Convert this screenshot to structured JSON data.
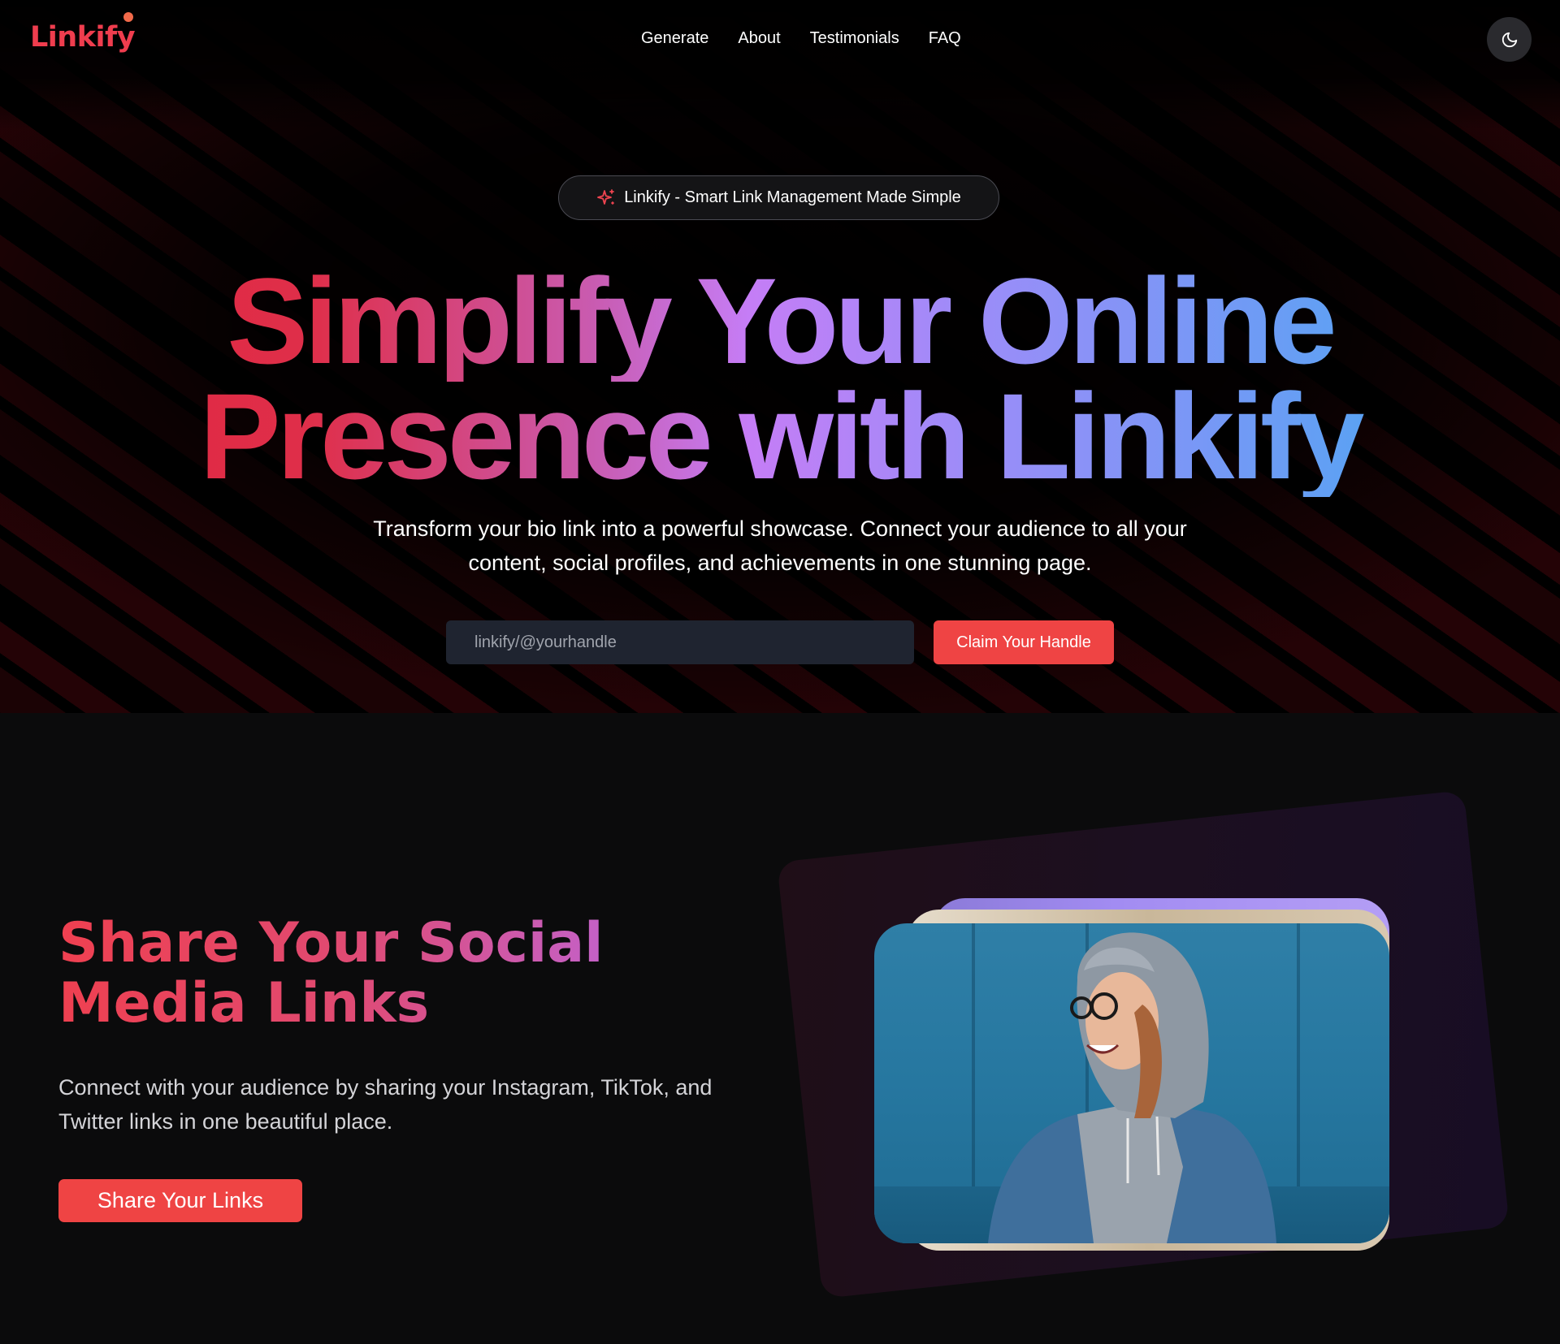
{
  "brand": {
    "logo_text": "Linkify",
    "accent_color": "#ef4444",
    "dot_color": "#f26a4a"
  },
  "nav": {
    "links": [
      {
        "label": "Generate"
      },
      {
        "label": "About"
      },
      {
        "label": "Testimonials"
      },
      {
        "label": "FAQ"
      }
    ],
    "theme_toggle_icon": "moon-icon"
  },
  "hero": {
    "badge_icon": "sparkle-icon",
    "badge_text": "Linkify - Smart Link Management Made Simple",
    "headline_line1": "Simplify Your Online",
    "headline_line2": "Presence with Linkify",
    "subtitle_line1": "Transform your bio link into a powerful showcase. Connect your audience to all your",
    "subtitle_line2": "content, social profiles, and achievements in one stunning page.",
    "handle_input": {
      "placeholder": "linkify/@yourhandle",
      "value": ""
    },
    "cta_label": "Claim Your Handle",
    "gradient_colors": [
      "#e1233c",
      "#c57df6",
      "#5aa2f3"
    ]
  },
  "share_section": {
    "title": "Share Your Social Media Links",
    "description_line1": "Connect with your audience by sharing your Instagram, TikTok, and",
    "description_line2": "Twitter links in one beautiful place.",
    "button_label": "Share Your Links",
    "photo_alt": "smiling-woman-hoodie-denim-jacket-photo"
  }
}
